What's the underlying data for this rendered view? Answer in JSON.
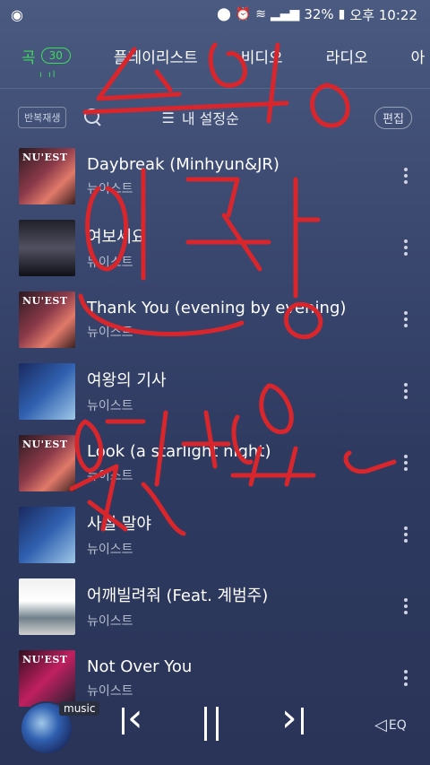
{
  "status": {
    "left_icon": "app-ring-icon",
    "icons": [
      "location-icon",
      "alarm-icon",
      "wifi-icon",
      "signal-icon"
    ],
    "battery": "32%",
    "time": "오후 10:22"
  },
  "tabs": [
    {
      "label": "곡",
      "count": "30",
      "active": true
    },
    {
      "label": "플레이리스트"
    },
    {
      "label": "비디오"
    },
    {
      "label": "라디오"
    },
    {
      "label": "아"
    }
  ],
  "toolbar": {
    "repeat_label": "반복재생",
    "sort_label": "내 설정순",
    "edit_label": "편집"
  },
  "tracks": [
    {
      "title": "Daybreak (Minhyun&JR)",
      "artist": "뉴이스트",
      "cover": "NU'EST"
    },
    {
      "title": "여보세요",
      "artist": "뉴이스트",
      "cover": ""
    },
    {
      "title": "Thank You (evening by evening)",
      "artist": "뉴이스트",
      "cover": "NU'EST"
    },
    {
      "title": "여왕의 기사",
      "artist": "뉴이스트",
      "cover": ""
    },
    {
      "title": "Look (a starlight night)",
      "artist": "뉴이스트",
      "cover": "NU'EST"
    },
    {
      "title": "사실 말야",
      "artist": "뉴이스트",
      "cover": ""
    },
    {
      "title": "어깨빌려줘 (Feat. 계범주)",
      "artist": "뉴이스트",
      "cover": ""
    },
    {
      "title": "Not Over You",
      "artist": "뉴이스트",
      "cover": "NU'EST"
    }
  ],
  "player": {
    "tag": "music",
    "eq_label": "EQ"
  },
  "colors": {
    "accent": "#3ddc5a",
    "scribble": "#d9262c"
  }
}
